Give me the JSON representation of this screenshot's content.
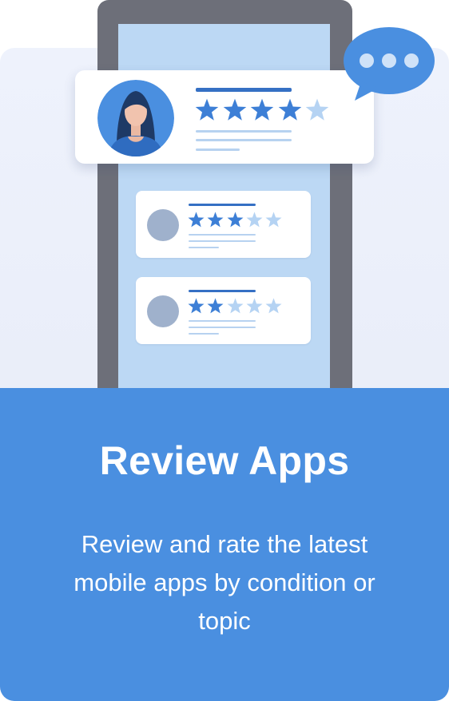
{
  "card": {
    "title": "Review Apps",
    "description": "Review and rate the latest mobile apps by condition or topic"
  },
  "reviews": [
    {
      "rating": 4,
      "max": 5
    },
    {
      "rating": 3,
      "max": 5
    },
    {
      "rating": 2,
      "max": 5
    }
  ],
  "colors": {
    "accent": "#4a8fe0",
    "star_filled": "#3d7fd6",
    "star_empty": "#b5d3f3",
    "phone_frame": "#6d6f79",
    "screen": "#bcd8f4"
  },
  "icons": [
    "user-avatar-icon",
    "star-icon",
    "chat-bubble-icon"
  ]
}
